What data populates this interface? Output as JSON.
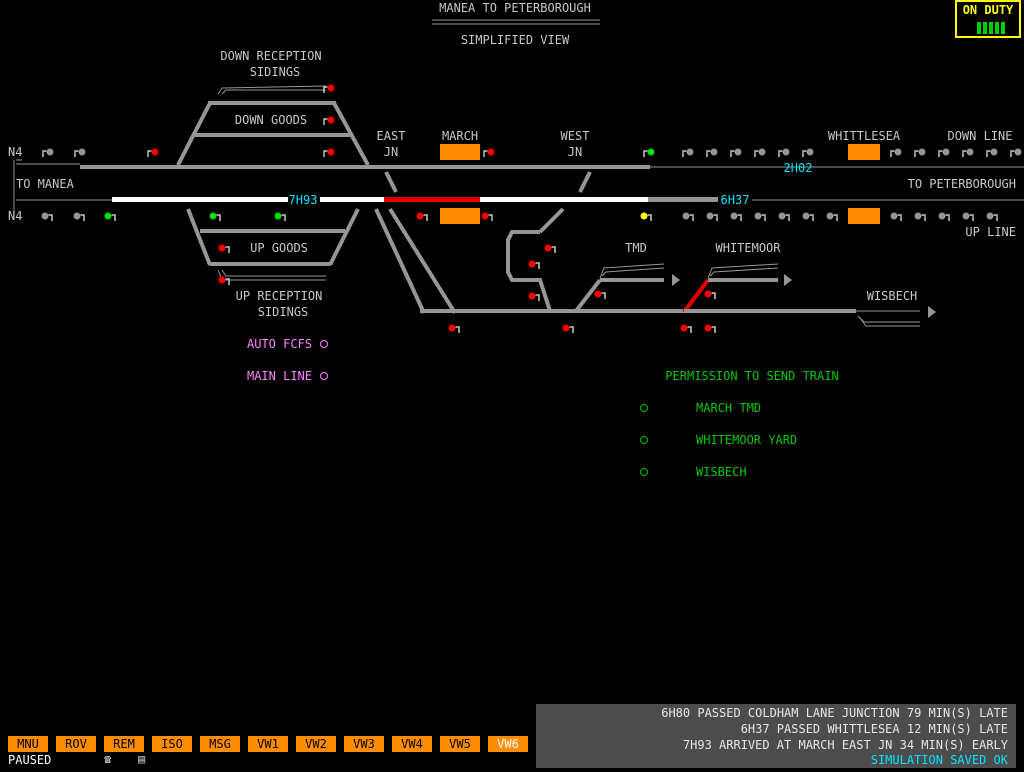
{
  "header": {
    "title": "MANEA TO PETERBOROUGH",
    "subtitle": "SIMPLIFIED VIEW"
  },
  "duty": {
    "label": "ON DUTY",
    "bars": 5
  },
  "labels": {
    "down_reception_1": "DOWN RECEPTION",
    "down_reception_2": "SIDINGS",
    "down_goods": "DOWN GOODS",
    "up_goods": "UP GOODS",
    "up_reception_1": "UP RECEPTION",
    "up_reception_2": "SIDINGS",
    "east_jn_1": "EAST",
    "east_jn_2": "JN",
    "march": "MARCH",
    "west_jn_1": "WEST",
    "west_jn_2": "JN",
    "whittlesea": "WHITTLESEA",
    "down_line": "DOWN LINE",
    "up_line": "UP LINE",
    "to_manea": "TO MANEA",
    "to_peterborough": "TO PETERBOROUGH",
    "n4_top": "N4",
    "n4_bottom": "N4",
    "tmd": "TMD",
    "whitemoor": "WHITEMOOR",
    "wisbech": "WISBECH"
  },
  "train_ids": {
    "down_main": "2H02",
    "up_main_west": "7H93",
    "up_main_east": "6H37"
  },
  "options": [
    {
      "label": "AUTO FCFS",
      "name": "auto-fcfs-toggle"
    },
    {
      "label": "MAIN LINE",
      "name": "main-line-toggle"
    }
  ],
  "permission": {
    "title": "PERMISSION TO SEND TRAIN",
    "items": [
      {
        "label": "MARCH TMD",
        "name": "permission-march-tmd"
      },
      {
        "label": "WHITEMOOR YARD",
        "name": "permission-whitemoor-yard"
      },
      {
        "label": "WISBECH",
        "name": "permission-wisbech"
      }
    ]
  },
  "toolbar": [
    {
      "label": "MNU",
      "name": "menu-button"
    },
    {
      "label": "ROV",
      "name": "rov-button"
    },
    {
      "label": "REM",
      "name": "rem-button"
    },
    {
      "label": "ISO",
      "name": "iso-button"
    },
    {
      "label": "MSG",
      "name": "msg-button"
    },
    {
      "label": "VW1",
      "name": "view1-button"
    },
    {
      "label": "VW2",
      "name": "view2-button"
    },
    {
      "label": "VW3",
      "name": "view3-button"
    },
    {
      "label": "VW4",
      "name": "view4-button"
    },
    {
      "label": "VW5",
      "name": "view5-button"
    },
    {
      "label": "VW6",
      "name": "view6-button",
      "active": true
    }
  ],
  "status": "PAUSED",
  "messages": [
    "6H80 PASSED COLDHAM LANE JUNCTION 79 MIN(S) LATE",
    "6H37 PASSED WHITTLESEA 12 MIN(S) LATE",
    "7H93 ARRIVED AT MARCH EAST JN 34 MIN(S) EARLY",
    "SIMULATION SAVED OK"
  ],
  "colors": {
    "background": "#000000",
    "track": "#969696",
    "route_set": "#ffffff",
    "occupied": "#e00000",
    "platform": "#ff8c00",
    "signal_red": "#ff0000",
    "signal_green": "#00e000",
    "signal_yellow": "#ffff00",
    "train_id": "#00e5ff",
    "option_text": "#ff80ff",
    "permission_text": "#00c800",
    "label_text": "#c8c8c8"
  }
}
